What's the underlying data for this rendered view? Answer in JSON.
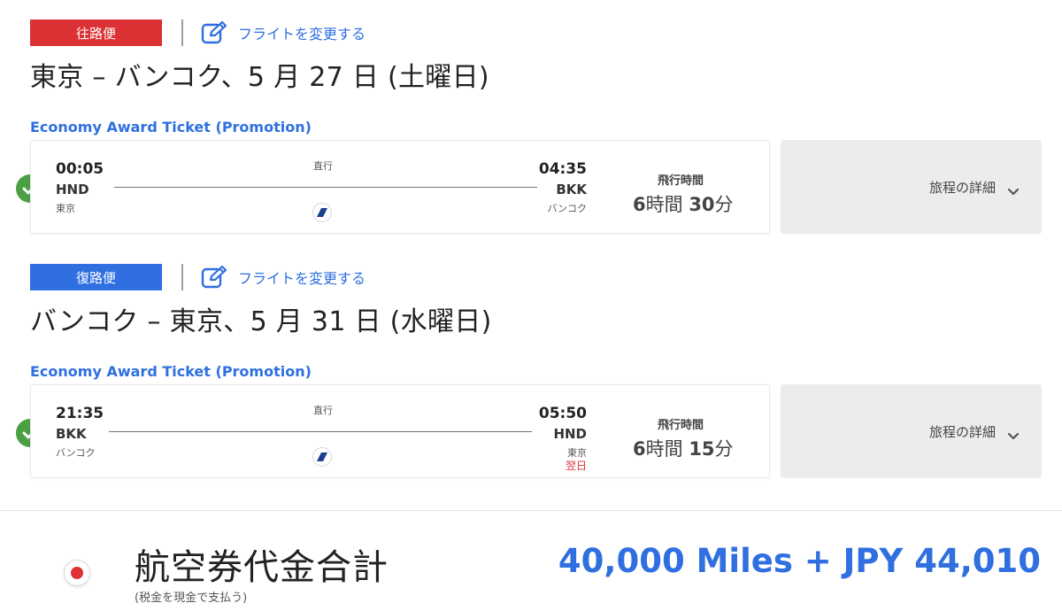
{
  "outbound": {
    "badge": "往路便",
    "change_link": "フライトを変更する",
    "route_title": "東京 – バンコク、5 月 27 日 (土曜日)",
    "fare_class": "Economy Award Ticket (Promotion)",
    "dep_time": "00:05",
    "dep_code": "HND",
    "dep_city": "東京",
    "arr_time": "04:35",
    "arr_code": "BKK",
    "arr_city": "バンコク",
    "next_day": "",
    "stops": "直行",
    "duration_label": "飛行時間",
    "duration_h": "6",
    "duration_h_unit": "時間",
    "duration_m": "30",
    "duration_m_unit": "分",
    "details_label": "旅程の詳細",
    "badge_color": "#dc3236"
  },
  "return": {
    "badge": "復路便",
    "change_link": "フライトを変更する",
    "route_title": "バンコク – 東京、5 月 31 日 (水曜日)",
    "fare_class": "Economy Award Ticket (Promotion)",
    "dep_time": "21:35",
    "dep_code": "BKK",
    "dep_city": "バンコク",
    "arr_time": "05:50",
    "arr_code": "HND",
    "arr_city": "東京",
    "next_day": "翌日",
    "stops": "直行",
    "duration_label": "飛行時間",
    "duration_h": "6",
    "duration_h_unit": "時間",
    "duration_m": "15",
    "duration_m_unit": "分",
    "details_label": "旅程の詳細",
    "badge_color": "#2f6fe0"
  },
  "total": {
    "title": "航空券代金合計",
    "subtitle": "(税金を現金で支払う)",
    "amount": "40,000 Miles + JPY 44,010",
    "selected": true
  },
  "colors": {
    "accent_blue": "#2f6fe0",
    "accent_red": "#dc3236",
    "check_green": "#4aa043"
  },
  "icons": {
    "edit": "edit-icon",
    "check": "check-circle-icon",
    "airline": "airline-logo-icon",
    "chevron": "chevron-down-icon"
  }
}
